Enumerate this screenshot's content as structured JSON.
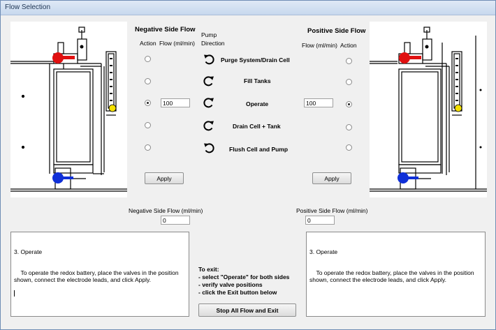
{
  "window": {
    "title": "Flow Selection"
  },
  "negative": {
    "header": "Negative Side Flow",
    "action_label": "Action",
    "flow_label": "Flow (ml/min)",
    "flow_value": "100",
    "selected_index": 2,
    "apply_label": "Apply",
    "summary_label": "Negative Side Flow  (ml/min)",
    "summary_value": "0",
    "description_title": "3. Operate",
    "description_body": "To operate the redox battery, place the valves in the position shown, connect the electrode leads, and click Apply."
  },
  "positive": {
    "header": "Positive Side Flow",
    "action_label": "Action",
    "flow_label": "Flow (ml/min)",
    "flow_value": "100",
    "selected_index": 2,
    "apply_label": "Apply",
    "summary_label": "Positive Side Flow  (ml/min)",
    "summary_value": "0",
    "description_title": "3. Operate",
    "description_body": "To operate the redox battery, place the valves in the position shown, connect the electrode leads, and click Apply."
  },
  "pump": {
    "header_line1": "Pump",
    "header_line2": "Direction"
  },
  "actions": [
    {
      "label": "Purge System/Drain Cell",
      "direction": "counterclockwise"
    },
    {
      "label": "Fill Tanks",
      "direction": "clockwise"
    },
    {
      "label": "Operate",
      "direction": "clockwise"
    },
    {
      "label": "Drain Cell + Tank",
      "direction": "clockwise"
    },
    {
      "label": "Flush Cell and Pump",
      "direction": "counterclockwise"
    }
  ],
  "exit_instructions": {
    "line1": "To exit:",
    "line2": "- select \"Operate\" for both sides",
    "line3": "- verify valve positions",
    "line4": "- click the Exit button  below"
  },
  "exit_button_label": "Stop All Flow and Exit",
  "colors": {
    "valve_red": "#e01010",
    "valve_blue": "#1030d8",
    "flow_indicator": "#f4e000"
  }
}
